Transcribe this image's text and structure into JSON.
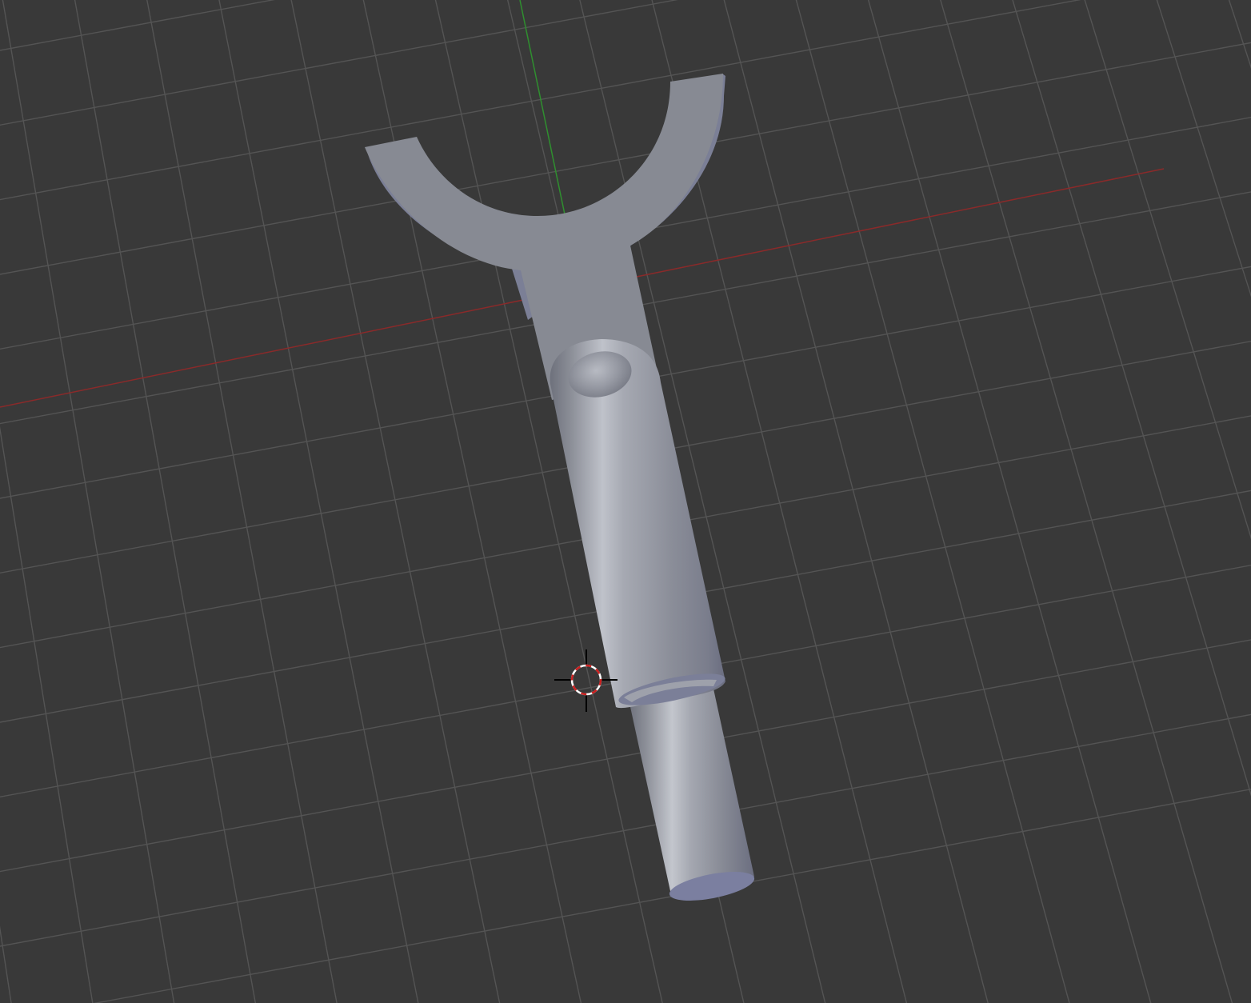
{
  "viewport": {
    "background": "#393939",
    "grid_color": "#545454",
    "x_axis_color": "#8a2a2a",
    "y_axis_color": "#2f8f2f",
    "mesh_color": "#8a8d96",
    "mesh_highlight": "#b9bcc4",
    "mesh_shadow": "#6b6e79",
    "mesh_edge": "#7b7f96",
    "cursor_colors": [
      "#ffffff",
      "#cc2020",
      "#000000"
    ]
  },
  "objects": [
    {
      "name": "fork-plate"
    },
    {
      "name": "cylinder-upper"
    },
    {
      "name": "cylinder-lower"
    }
  ],
  "tools": [
    {
      "name": "3d-cursor"
    }
  ]
}
